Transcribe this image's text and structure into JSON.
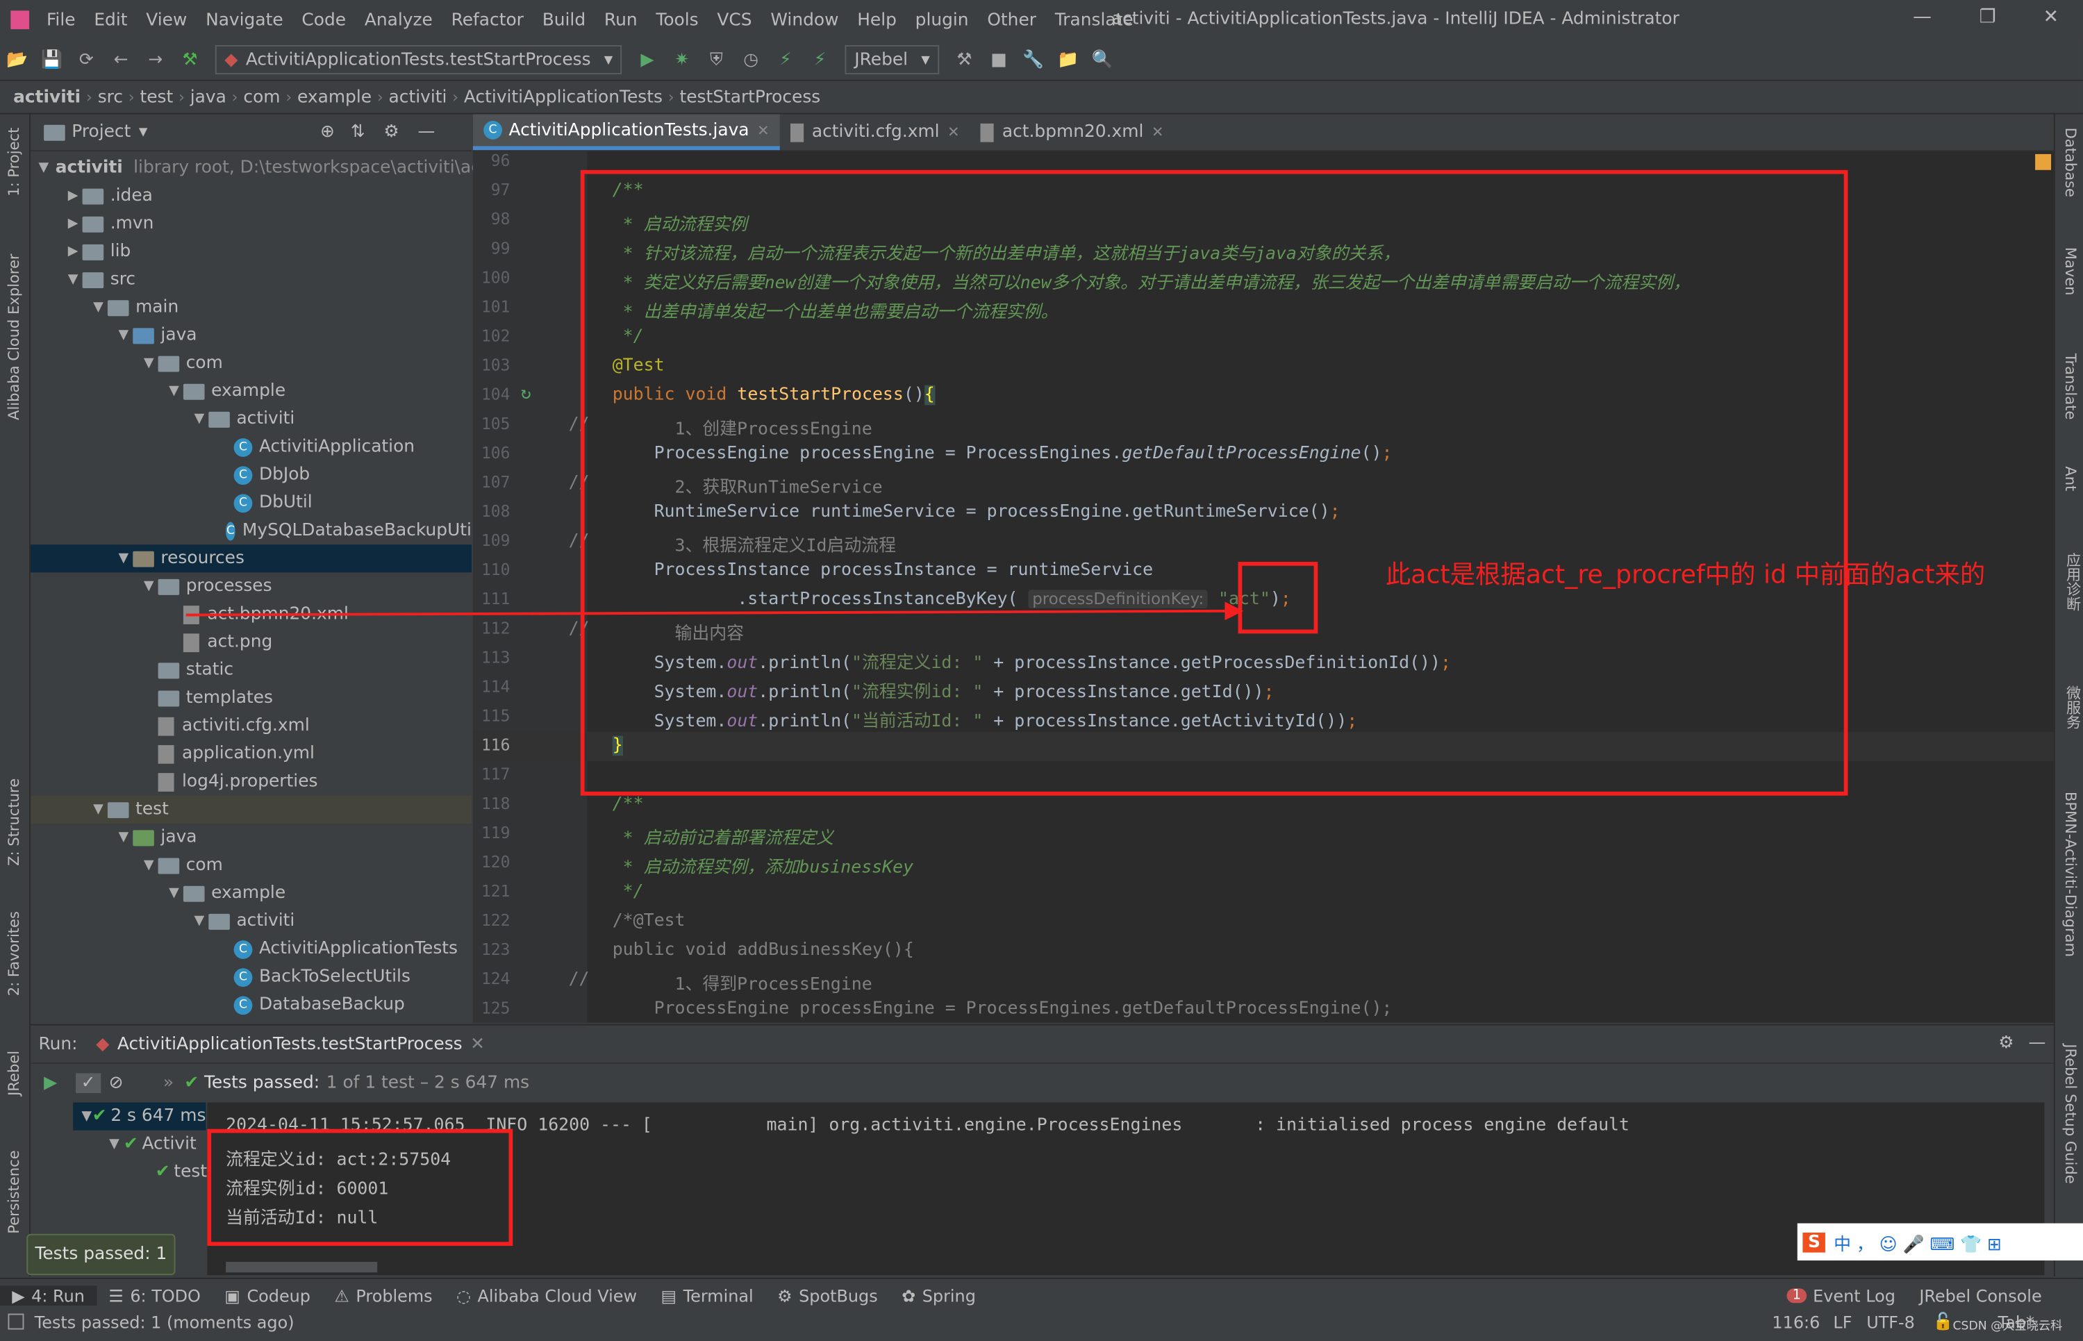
{
  "window": {
    "title": "activiti - ActivitiApplicationTests.java - IntelliJ IDEA - Administrator",
    "menu": [
      "File",
      "Edit",
      "View",
      "Navigate",
      "Code",
      "Analyze",
      "Refactor",
      "Build",
      "Run",
      "Tools",
      "VCS",
      "Window",
      "Help",
      "plugin",
      "Other",
      "Translate"
    ]
  },
  "toolbar": {
    "run_config": "ActivitiApplicationTests.testStartProcess",
    "jrebel": "JRebel"
  },
  "breadcrumbs": [
    "activiti",
    "src",
    "test",
    "java",
    "com",
    "example",
    "activiti",
    "ActivitiApplicationTests",
    "testStartProcess"
  ],
  "left_strip": [
    "1: Project",
    "Alibaba Cloud Explorer",
    "Z: Structure",
    "2: Favorites",
    "JRebel",
    "Persistence"
  ],
  "right_strip": [
    "Database",
    "Maven",
    "Translate",
    "Ant",
    "应用诊断",
    "微服务",
    "BPMN-Activiti-Diagram",
    "JRebel Setup Guide"
  ],
  "project": {
    "title": "Project",
    "tree": [
      {
        "d": 0,
        "label": "activiti",
        "extra": "library root,  D:\\testworkspace\\activiti\\ac",
        "icon": "module",
        "open": true
      },
      {
        "d": 1,
        "label": ".idea",
        "icon": "folder",
        "open": false
      },
      {
        "d": 1,
        "label": ".mvn",
        "icon": "folder",
        "open": false
      },
      {
        "d": 1,
        "label": "lib",
        "icon": "folder",
        "open": false
      },
      {
        "d": 1,
        "label": "src",
        "icon": "folder",
        "open": true
      },
      {
        "d": 2,
        "label": "main",
        "icon": "folder",
        "open": true
      },
      {
        "d": 3,
        "label": "java",
        "icon": "folder-blue",
        "open": true
      },
      {
        "d": 4,
        "label": "com",
        "icon": "package",
        "open": true
      },
      {
        "d": 5,
        "label": "example",
        "icon": "package",
        "open": true
      },
      {
        "d": 6,
        "label": "activiti",
        "icon": "package",
        "open": true
      },
      {
        "d": 7,
        "label": "ActivitiApplication",
        "icon": "class"
      },
      {
        "d": 7,
        "label": "DbJob",
        "icon": "class"
      },
      {
        "d": 7,
        "label": "DbUtil",
        "icon": "class"
      },
      {
        "d": 7,
        "label": "MySQLDatabaseBackupUti",
        "icon": "class"
      },
      {
        "d": 3,
        "label": "resources",
        "icon": "folder-res",
        "open": true,
        "selected": true
      },
      {
        "d": 4,
        "label": "processes",
        "icon": "folder",
        "open": true
      },
      {
        "d": 5,
        "label": "act.bpmn20.xml",
        "icon": "file"
      },
      {
        "d": 5,
        "label": "act.png",
        "icon": "file"
      },
      {
        "d": 4,
        "label": "static",
        "icon": "folder"
      },
      {
        "d": 4,
        "label": "templates",
        "icon": "folder"
      },
      {
        "d": 4,
        "label": "activiti.cfg.xml",
        "icon": "file"
      },
      {
        "d": 4,
        "label": "application.yml",
        "icon": "file"
      },
      {
        "d": 4,
        "label": "log4j.properties",
        "icon": "file"
      },
      {
        "d": 2,
        "label": "test",
        "icon": "folder",
        "open": true,
        "highlight": true
      },
      {
        "d": 3,
        "label": "java",
        "icon": "folder-green",
        "open": true
      },
      {
        "d": 4,
        "label": "com",
        "icon": "package",
        "open": true
      },
      {
        "d": 5,
        "label": "example",
        "icon": "package",
        "open": true
      },
      {
        "d": 6,
        "label": "activiti",
        "icon": "package",
        "open": true
      },
      {
        "d": 7,
        "label": "ActivitiApplicationTests",
        "icon": "class"
      },
      {
        "d": 7,
        "label": "BackToSelectUtils",
        "icon": "class"
      },
      {
        "d": 7,
        "label": "DatabaseBackup",
        "icon": "class"
      }
    ]
  },
  "editor": {
    "tabs": [
      {
        "label": "ActivitiApplicationTests.java",
        "active": true
      },
      {
        "label": "activiti.cfg.xml",
        "active": false
      },
      {
        "label": "act.bpmn20.xml",
        "active": false
      }
    ],
    "current_line": 116,
    "lines": [
      {
        "n": 96,
        "s": []
      },
      {
        "n": 97,
        "s": [
          {
            "k": "doc",
            "t": "/**"
          }
        ]
      },
      {
        "n": 98,
        "s": [
          {
            "k": "doc",
            "t": " * 启动流程实例"
          }
        ]
      },
      {
        "n": 99,
        "s": [
          {
            "k": "doc",
            "t": " * 针对该流程，启动一个流程表示发起一个新的出差申请单，这就相当于java类与java对象的关系，"
          }
        ]
      },
      {
        "n": 100,
        "s": [
          {
            "k": "doc",
            "t": " * 类定义好后需要new创建一个对象使用，当然可以new多个对象。对于请出差申请流程，张三发起一个出差申请单需要启动一个流程实例，"
          }
        ]
      },
      {
        "n": 101,
        "s": [
          {
            "k": "doc",
            "t": " * 出差申请单发起一个出差单也需要启动一个流程实例。"
          }
        ]
      },
      {
        "n": 102,
        "s": [
          {
            "k": "doc",
            "t": " */"
          }
        ]
      },
      {
        "n": 103,
        "s": [
          {
            "k": "ann",
            "t": "@Test"
          }
        ]
      },
      {
        "n": 104,
        "s": [
          {
            "k": "kw",
            "t": "public void "
          },
          {
            "k": "fn",
            "t": "testStartProcess"
          },
          {
            "k": "pl",
            "t": "()"
          },
          {
            "k": "br",
            "t": "{"
          }
        ]
      },
      {
        "n": 105,
        "c": true,
        "s": [
          {
            "k": "cmt",
            "t": "      1、创建ProcessEngine"
          }
        ]
      },
      {
        "n": 106,
        "s": [
          {
            "k": "pl",
            "t": "    ProcessEngine processEngine = ProcessEngines."
          },
          {
            "k": "it",
            "t": "getDefaultProcessEngine"
          },
          {
            "k": "pl",
            "t": "()"
          },
          {
            "k": "kw",
            "t": ";"
          }
        ]
      },
      {
        "n": 107,
        "c": true,
        "s": [
          {
            "k": "cmt",
            "t": "      2、获取RunTimeService"
          }
        ]
      },
      {
        "n": 108,
        "s": [
          {
            "k": "pl",
            "t": "    RuntimeService runtimeService = processEngine.getRuntimeService()"
          },
          {
            "k": "kw",
            "t": ";"
          }
        ]
      },
      {
        "n": 109,
        "c": true,
        "s": [
          {
            "k": "cmt",
            "t": "      3、根据流程定义Id启动流程"
          }
        ]
      },
      {
        "n": 110,
        "s": [
          {
            "k": "pl",
            "t": "    ProcessInstance processInstance = runtimeService"
          }
        ]
      },
      {
        "n": 111,
        "s": [
          {
            "k": "pl",
            "t": "            .startProcessInstanceByKey( "
          },
          {
            "k": "hint",
            "t": "processDefinitionKey:"
          },
          {
            "k": "str",
            "t": " \"act\""
          },
          {
            "k": "pl",
            "t": ")"
          },
          {
            "k": "kw",
            "t": ";"
          }
        ]
      },
      {
        "n": 112,
        "c": true,
        "s": [
          {
            "k": "cmt",
            "t": "      输出内容"
          }
        ]
      },
      {
        "n": 113,
        "s": [
          {
            "k": "pl",
            "t": "    System."
          },
          {
            "k": "st",
            "t": "out"
          },
          {
            "k": "pl",
            "t": ".println("
          },
          {
            "k": "str",
            "t": "\"流程定义id: \""
          },
          {
            "k": "pl",
            "t": " + processInstance.getProcessDefinitionId())"
          },
          {
            "k": "kw",
            "t": ";"
          }
        ]
      },
      {
        "n": 114,
        "s": [
          {
            "k": "pl",
            "t": "    System."
          },
          {
            "k": "st",
            "t": "out"
          },
          {
            "k": "pl",
            "t": ".println("
          },
          {
            "k": "str",
            "t": "\"流程实例id: \""
          },
          {
            "k": "pl",
            "t": " + processInstance.getId())"
          },
          {
            "k": "kw",
            "t": ";"
          }
        ]
      },
      {
        "n": 115,
        "s": [
          {
            "k": "pl",
            "t": "    System."
          },
          {
            "k": "st",
            "t": "out"
          },
          {
            "k": "pl",
            "t": ".println("
          },
          {
            "k": "str",
            "t": "\"当前活动Id: \""
          },
          {
            "k": "pl",
            "t": " + processInstance.getActivityId())"
          },
          {
            "k": "kw",
            "t": ";"
          }
        ]
      },
      {
        "n": 116,
        "s": [
          {
            "k": "br",
            "t": "}"
          }
        ]
      },
      {
        "n": 117,
        "s": []
      },
      {
        "n": 118,
        "s": [
          {
            "k": "doc",
            "t": "/**"
          }
        ]
      },
      {
        "n": 119,
        "s": [
          {
            "k": "doc",
            "t": " * 启动前记着部署流程定义"
          }
        ]
      },
      {
        "n": 120,
        "s": [
          {
            "k": "doc",
            "t": " * 启动流程实例，添加businessKey"
          }
        ]
      },
      {
        "n": 121,
        "s": [
          {
            "k": "doc",
            "t": " */"
          }
        ]
      },
      {
        "n": 122,
        "s": [
          {
            "k": "cmt",
            "t": "/*@Test"
          }
        ]
      },
      {
        "n": 123,
        "s": [
          {
            "k": "cmt",
            "t": "public void addBusinessKey(){"
          }
        ]
      },
      {
        "n": 124,
        "c": true,
        "s": [
          {
            "k": "cmt",
            "t": "      1、得到ProcessEngine"
          }
        ]
      },
      {
        "n": 125,
        "s": [
          {
            "k": "cmt",
            "t": "    ProcessEngine processEngine = ProcessEngines.getDefaultProcessEngine();"
          }
        ]
      }
    ],
    "annotation": "此act是根据act_re_procref中的  id 中前面的act来的"
  },
  "run": {
    "label": "Run:",
    "config": "ActivitiApplicationTests.testStartProcess",
    "status_prefix": "Tests passed:",
    "status_rest": "1 of 1 test – 2 s 647 ms",
    "tree": [
      {
        "label": "2 s 647 ms"
      },
      {
        "label": "Activit"
      },
      {
        "label": "test"
      }
    ],
    "console": [
      "2024-04-11 15:52:57.065  INFO 16200 --- [           main] org.activiti.engine.ProcessEngines       : initialised process engine default",
      "流程定义id: act:2:57504",
      "流程实例id: 60001",
      "当前活动Id: null"
    ],
    "tooltip": "Tests passed: 1"
  },
  "bottom_tools": [
    "4: Run",
    "6: TODO",
    "Codeup",
    "Problems",
    "Alibaba Cloud View",
    "Terminal",
    "SpotBugs",
    "Spring"
  ],
  "bottom_right": [
    "Event Log",
    "JRebel Console"
  ],
  "event_log_count": "1",
  "status": {
    "message": "Tests passed: 1 (moments ago)",
    "position": "116:6",
    "line_sep": "LF",
    "encoding": "UTF-8",
    "indent": "Tab*",
    "watermark": "CSDN @大宝晓云科"
  },
  "colors": {
    "accent": "#4a88c7",
    "annotation_red": "#f41f1f",
    "pass_green": "#4fb64d"
  }
}
